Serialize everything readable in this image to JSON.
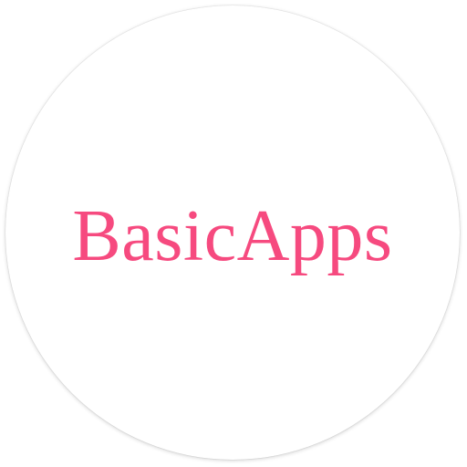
{
  "app": {
    "name": "BasicApps"
  },
  "colors": {
    "text": "#f64a7f",
    "background": "#ffffff"
  }
}
